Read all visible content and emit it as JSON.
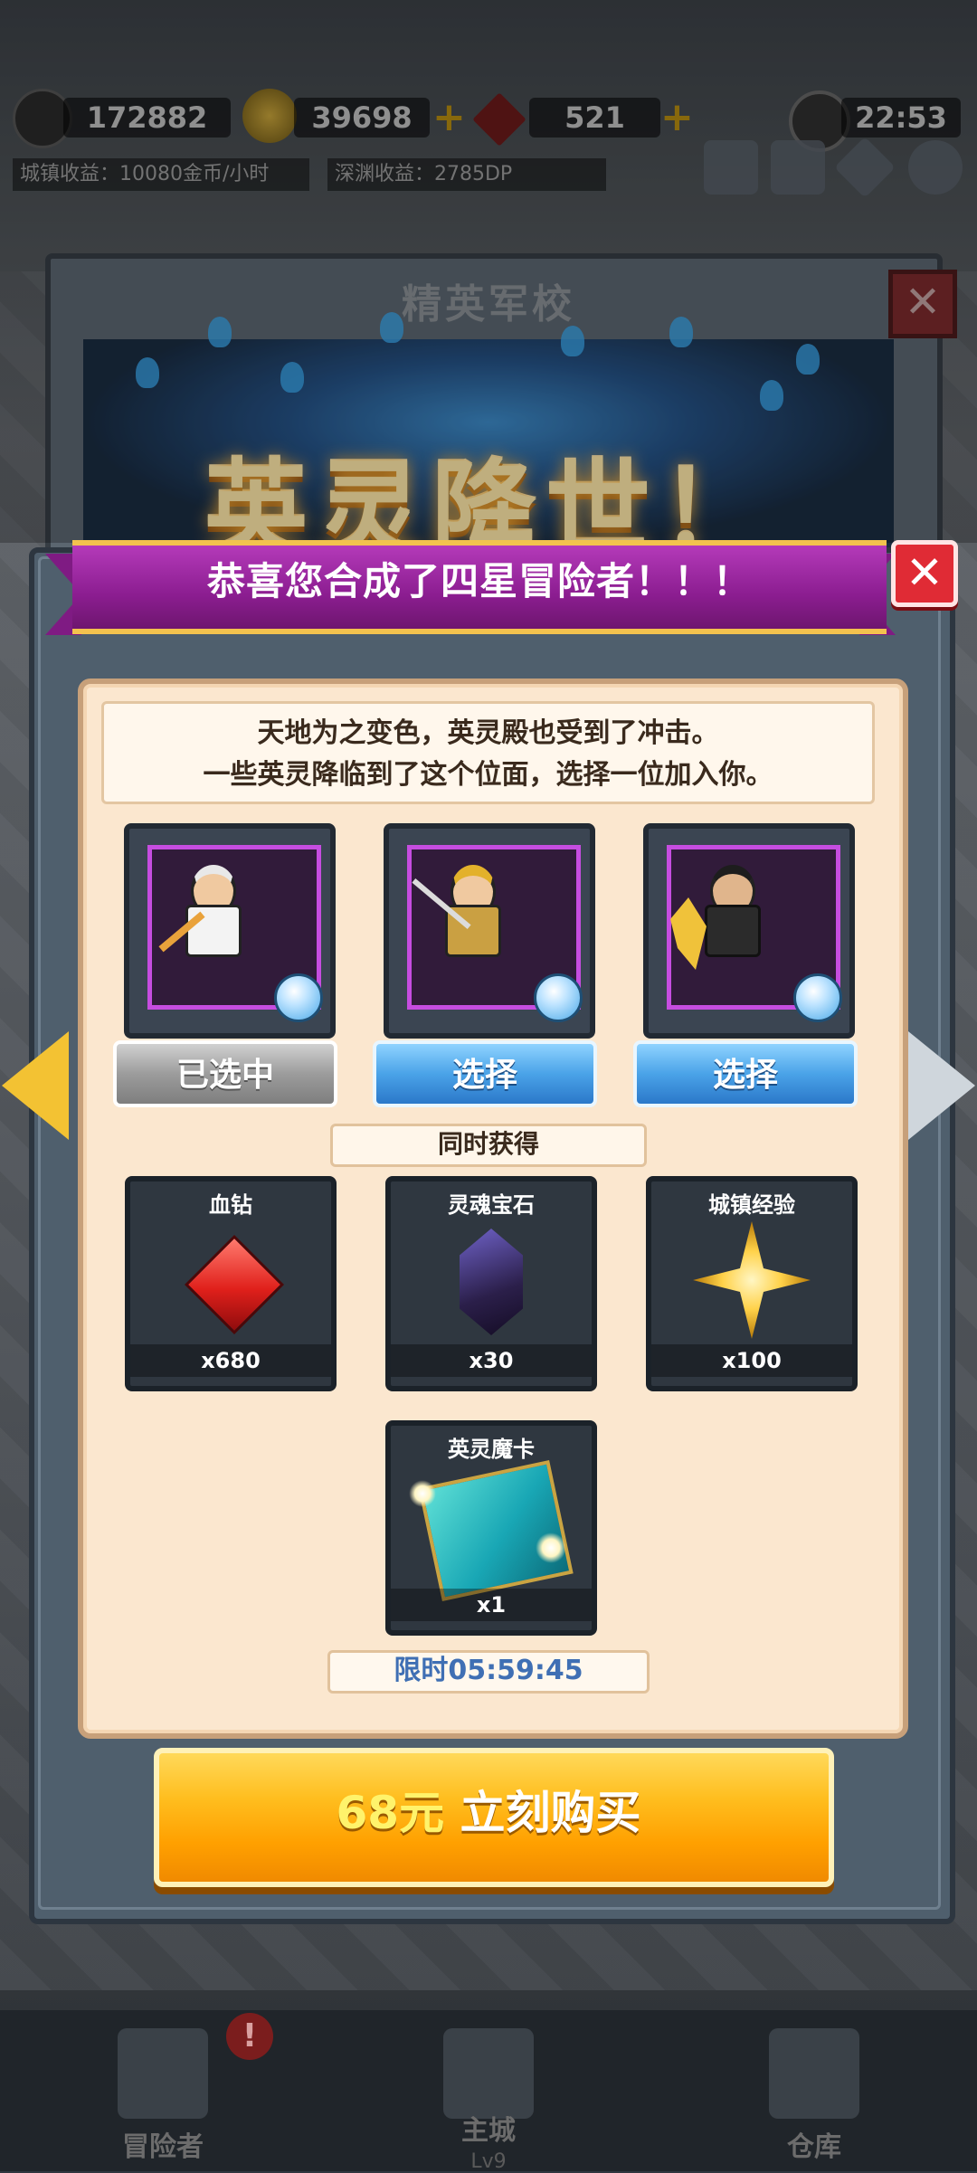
{
  "hud": {
    "power": "172882",
    "gold": "39698",
    "gems": "521",
    "clock": "22:53",
    "town_income": "城镇收益：10080金币/小时",
    "abyss_income": "深渊收益：2785DP"
  },
  "background_panel": {
    "title": "精英军校"
  },
  "event_art": {
    "title": "英灵降世！"
  },
  "dialog": {
    "ribbon_text": "恭喜您合成了四星冒险者！！！",
    "message_line1": "天地为之变色，英灵殿也受到了冲击。",
    "message_line2": "一些英灵降临到了这个位面，选择一位加入你。",
    "heroes": [
      {
        "button": "已选中",
        "selected": true
      },
      {
        "button": "选择",
        "selected": false
      },
      {
        "button": "选择",
        "selected": false
      }
    ],
    "also_get_label": "同时获得",
    "rewards": [
      {
        "name": "血钻",
        "qty": "x680",
        "icon": "red-diamond-icon"
      },
      {
        "name": "灵魂宝石",
        "qty": "x30",
        "icon": "soul-gem-icon"
      },
      {
        "name": "城镇经验",
        "qty": "x100",
        "icon": "town-exp-star-icon"
      },
      {
        "name": "英灵魔卡",
        "qty": "x1",
        "icon": "hero-magic-card-icon"
      }
    ],
    "timer": "限时05:59:45",
    "buy": {
      "price": "68元",
      "label": "立刻购买"
    }
  },
  "nav": {
    "items": [
      {
        "label": "冒险者",
        "sub": ""
      },
      {
        "label": "主城",
        "sub": "Lv9"
      },
      {
        "label": "仓库",
        "sub": ""
      }
    ],
    "badge": "!"
  },
  "colors": {
    "ribbon": "#8b1d90",
    "accent_gold": "#ffbe1f",
    "select_blue": "#4aa3e8",
    "timer_text": "#3f6fb4"
  }
}
